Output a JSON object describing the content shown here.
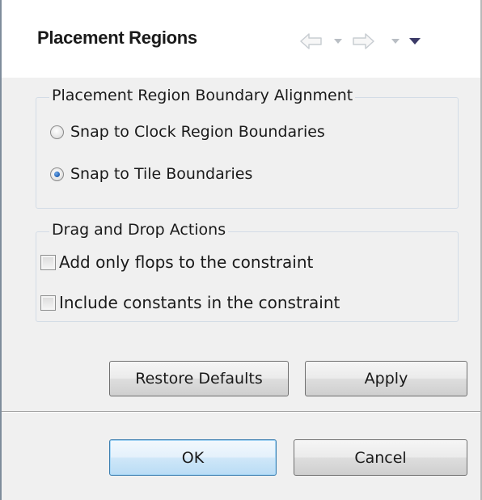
{
  "header": {
    "title": "Placement Regions"
  },
  "nav_icons": [
    "back-arrow-icon",
    "dropdown-icon",
    "forward-arrow-icon",
    "dropdown-icon",
    "view-menu-icon"
  ],
  "alignment_group": {
    "label": "Placement Region Boundary Alignment",
    "options": [
      {
        "label": "Snap to Clock Region Boundaries",
        "checked": false
      },
      {
        "label": "Snap to Tile Boundaries",
        "checked": true
      }
    ]
  },
  "drag_group": {
    "label": "Drag and Drop Actions",
    "options": [
      {
        "label": "Add only flops to the constraint",
        "checked": false
      },
      {
        "label": "Include constants in the constraint",
        "checked": false
      }
    ]
  },
  "buttons": {
    "restore_defaults": "Restore Defaults",
    "apply": "Apply",
    "ok": "OK",
    "cancel": "Cancel"
  },
  "colors": {
    "group_border": "#d3dce6",
    "default_button_border": "#3c7fb1",
    "menu_arrow": "#3b3a67",
    "nav_disabled": "#c8cdd2"
  }
}
